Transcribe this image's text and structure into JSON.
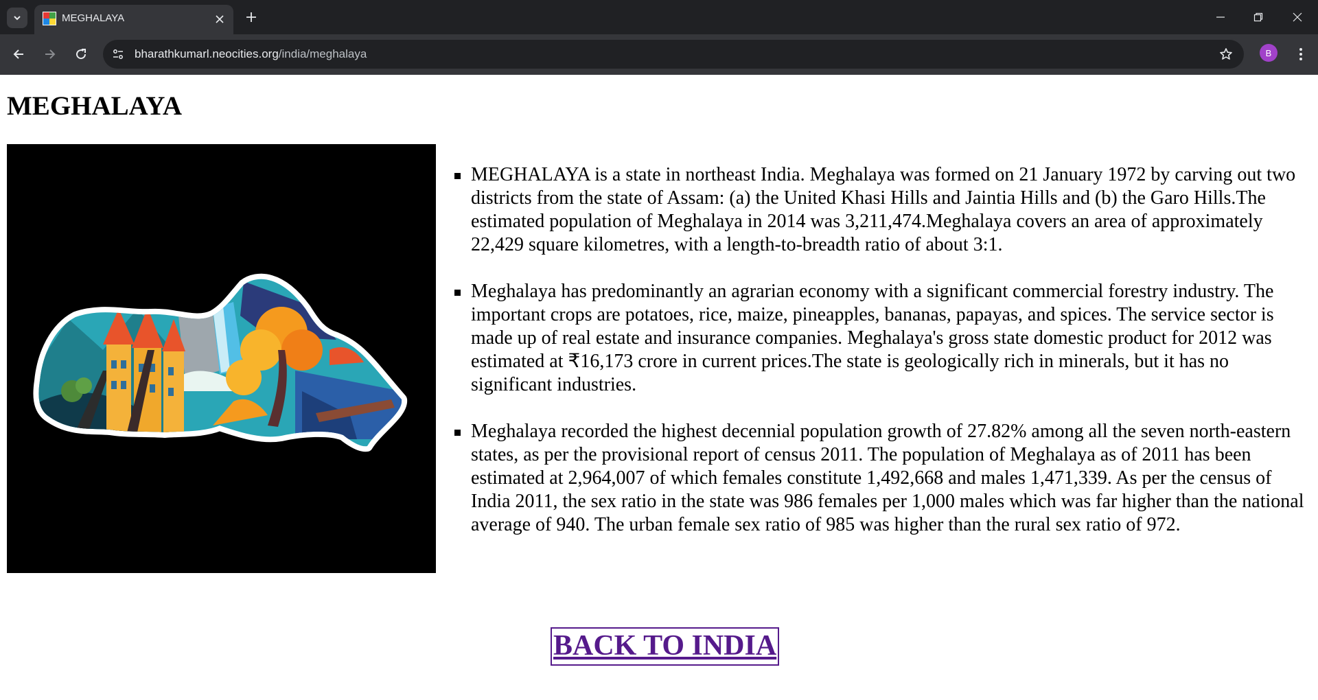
{
  "browser": {
    "tab_title": "MEGHALAYA",
    "url_host": "bharathkumarl.neocities.org",
    "url_path": "/india/meghalaya",
    "profile_initial": "B",
    "icons": [
      "chevron-down-icon",
      "close-icon",
      "plus-icon",
      "minimize-icon",
      "restore-icon",
      "back-arrow-icon",
      "forward-arrow-icon",
      "reload-icon",
      "site-info-icon",
      "star-icon",
      "kebab-menu-icon"
    ],
    "colors": {
      "tabstrip": "#202124",
      "toolbar": "#35363a",
      "avatar": "#a142c9"
    }
  },
  "page": {
    "heading": "MEGHALAYA",
    "paragraphs": [
      "MEGHALAYA is a state in northeast India. Meghalaya was formed on 21 January 1972 by carving out two districts from the state of Assam: (a) the United Khasi Hills and Jaintia Hills and (b) the Garo Hills.The estimated population of Meghalaya in 2014 was 3,211,474.Meghalaya covers an area of approximately 22,429 square kilometres, with a length-to-breadth ratio of about 3:1.",
      "Meghalaya has predominantly an agrarian economy with a significant commercial forestry industry. The important crops are potatoes, rice, maize, pineapples, bananas, papayas, and spices. The service sector is made up of real estate and insurance companies. Meghalaya's gross state domestic product for 2012 was estimated at ₹16,173 crore in current prices.The state is geologically rich in minerals, but it has no significant industries.",
      "Meghalaya recorded the highest decennial population growth of 27.82% among all the seven north-eastern states, as per the provisional report of census 2011. The population of Meghalaya as of 2011 has been estimated at 2,964,007 of which females constitute 1,492,668 and males 1,471,339. As per the census of India 2011, the sex ratio in the state was 986 females per 1,000 males which was far higher than the national average of 940. The urban female sex ratio of 985 was higher than the rural sex ratio of 972."
    ],
    "back_link": "BACK TO INDIA",
    "link_color": "#551a8b"
  }
}
